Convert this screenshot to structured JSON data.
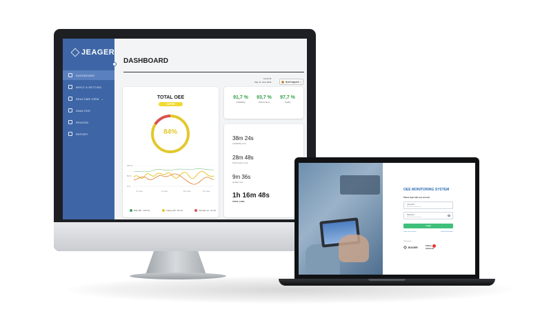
{
  "monitor": {
    "brand": "JEAGER",
    "sidebar_items": [
      {
        "label": "DASHBOARD",
        "icon": "bar-chart-icon",
        "active": true
      },
      {
        "label": "INPUT & SETTING",
        "icon": "settings-icon"
      },
      {
        "label": "REALTIME VIEW",
        "icon": "monitor-icon",
        "caret": "⌄"
      },
      {
        "label": "ANALYSIS",
        "icon": "bulb-icon"
      },
      {
        "label": "REASON",
        "icon": "file-icon"
      },
      {
        "label": "REPORT",
        "icon": "report-icon"
      }
    ],
    "page_title": "DASHBOARD",
    "time": "14:3x:25",
    "date": "May 11 June 2024",
    "user_name": "Budi Nugraha",
    "total_oee": {
      "title": "TOTAL OEE",
      "badge": "SUPER",
      "value": "84%",
      "percent": 84,
      "color_good": "#e3c82b",
      "color_bad": "#d9534f",
      "chart": {
        "y_ticks": [
          "100 %",
          "50 %",
          "0 %"
        ],
        "x_ticks": [
          "8. june",
          "9. june",
          "10. june",
          "11. june"
        ]
      },
      "legend": [
        {
          "label": "Baik (85 - 100 %)",
          "color": "#3ba55c"
        },
        {
          "label": "Cukup (65 - 84 %)",
          "color": "#e8c52c"
        },
        {
          "label": "Rendah (0 - 64 %)",
          "color": "#d9534f"
        }
      ]
    },
    "metrics": [
      {
        "value": "91,7 %",
        "label": "Availability"
      },
      {
        "value": "93,7 %",
        "label": "Performance"
      },
      {
        "value": "97,7 %",
        "label": "Quality"
      }
    ],
    "losses": [
      {
        "value": "38m 24s",
        "label": "Availability Loss"
      },
      {
        "value": "28m 48s",
        "label": "Performance Loss"
      },
      {
        "value": "9m 36s",
        "label": "Quality Loss"
      },
      {
        "value": "1h 16m 48s",
        "label": "TOTAL LOSS",
        "total": true
      }
    ]
  },
  "laptop": {
    "title": "OEE MONITORING SYSTEM",
    "subtitle": "Please login with your account",
    "username": {
      "label": "Username",
      "placeholder": "Masukkan username"
    },
    "password": {
      "label": "Password",
      "placeholder": "Masukkan password"
    },
    "login_label": "Login",
    "link_left": "Login user account",
    "link_right": "Forgot Password?",
    "powered_by": "Powered by",
    "brand_a": "JEAGER",
    "brand_b_line1": "Telkom",
    "brand_b_line2": "Indonesia"
  }
}
